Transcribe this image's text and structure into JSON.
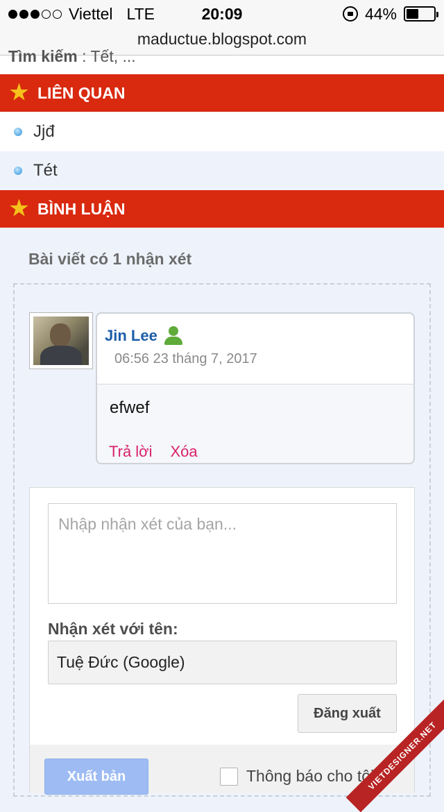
{
  "status_bar": {
    "signal_dots_filled": 3,
    "signal_dots_total": 5,
    "carrier": "Viettel",
    "network": "LTE",
    "time": "20:09",
    "battery": "44%",
    "battery_level": 0.44
  },
  "browser": {
    "url": "maductue.blogspot.com"
  },
  "search": {
    "label": "Tìm kiếm",
    "value": ": Tết, ..."
  },
  "related": {
    "header": "LIÊN QUAN",
    "items": [
      "Jjđ",
      "Tét"
    ]
  },
  "comments": {
    "header": "BÌNH LUẬN",
    "count_text": "Bài viết có 1 nhận xét",
    "list": [
      {
        "author": "Jin Lee",
        "timestamp": "06:56 23 tháng 7, 2017",
        "body": "efwef",
        "reply_label": "Trả lời",
        "delete_label": "Xóa"
      }
    ]
  },
  "form": {
    "placeholder": "Nhập nhận xét của bạn...",
    "name_label": "Nhận xét với tên:",
    "identity": "Tuệ Đức (Google)",
    "signout_label": "Đăng xuất",
    "publish_label": "Xuất bản",
    "notify_label": "Thông báo cho tôi"
  },
  "watermark": "VIETDESIGNER.NET"
}
